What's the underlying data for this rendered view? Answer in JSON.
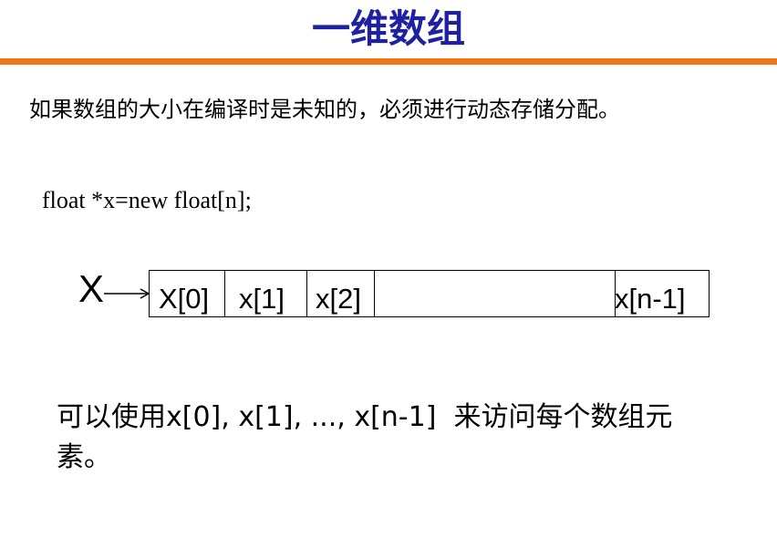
{
  "slide": {
    "title": "一维数组",
    "intro": "如果数组的大小在编译时是未知的，必须进行动态存储分配。",
    "code": "float *x=new float[n];",
    "pointer_var": "X",
    "cells": [
      "X[0]",
      "x[1]",
      "x[2]",
      "x[n-1]"
    ],
    "footer_line1": "可以使用x[0], x[1], ..., x[n-1]  来访问每个数组元",
    "footer_line2": "素。"
  },
  "colors": {
    "title": "#1e22a0",
    "rule": "#f0761c"
  }
}
